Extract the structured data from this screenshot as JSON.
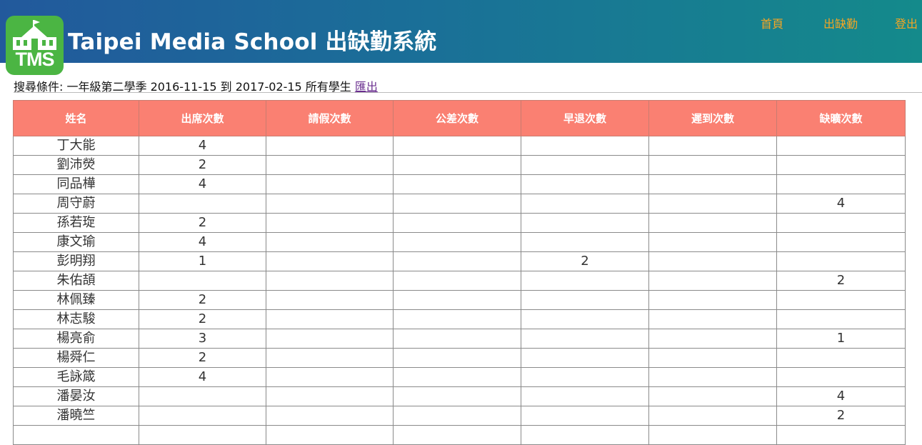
{
  "app": {
    "logo_text": "TMS",
    "title": "Taipei Media School 出缺勤系統"
  },
  "nav": {
    "home": "首頁",
    "attendance": "出缺勤",
    "logout": "登出"
  },
  "query": {
    "label": "搜尋條件: 一年級第二學季 2016-11-15 到 2017-02-15 所有學生",
    "export_link": "匯出"
  },
  "table": {
    "headers": [
      "姓名",
      "出席次數",
      "請假次數",
      "公差次數",
      "早退次數",
      "遲到次數",
      "缺曠次數"
    ],
    "rows": [
      [
        "丁大能",
        "4",
        "",
        "",
        "",
        "",
        ""
      ],
      [
        "劉沛熒",
        "2",
        "",
        "",
        "",
        "",
        ""
      ],
      [
        "同品樺",
        "4",
        "",
        "",
        "",
        "",
        ""
      ],
      [
        "周守蔚",
        "",
        "",
        "",
        "",
        "",
        "4"
      ],
      [
        "孫若琁",
        "2",
        "",
        "",
        "",
        "",
        ""
      ],
      [
        "康文瑜",
        "4",
        "",
        "",
        "",
        "",
        ""
      ],
      [
        "彭明翔",
        "1",
        "",
        "",
        "2",
        "",
        ""
      ],
      [
        "朱佑頡",
        "",
        "",
        "",
        "",
        "",
        "2"
      ],
      [
        "林佩臻",
        "2",
        "",
        "",
        "",
        "",
        ""
      ],
      [
        "林志駿",
        "2",
        "",
        "",
        "",
        "",
        ""
      ],
      [
        "楊亮俞",
        "3",
        "",
        "",
        "",
        "",
        "1"
      ],
      [
        "楊舜仁",
        "2",
        "",
        "",
        "",
        "",
        ""
      ],
      [
        "毛詠箴",
        "4",
        "",
        "",
        "",
        "",
        ""
      ],
      [
        "潘晏汝",
        "",
        "",
        "",
        "",
        "",
        "4"
      ],
      [
        "潘曉竺",
        "",
        "",
        "",
        "",
        "",
        "2"
      ],
      [
        "",
        "",
        "",
        "",
        "",
        "",
        ""
      ]
    ]
  }
}
